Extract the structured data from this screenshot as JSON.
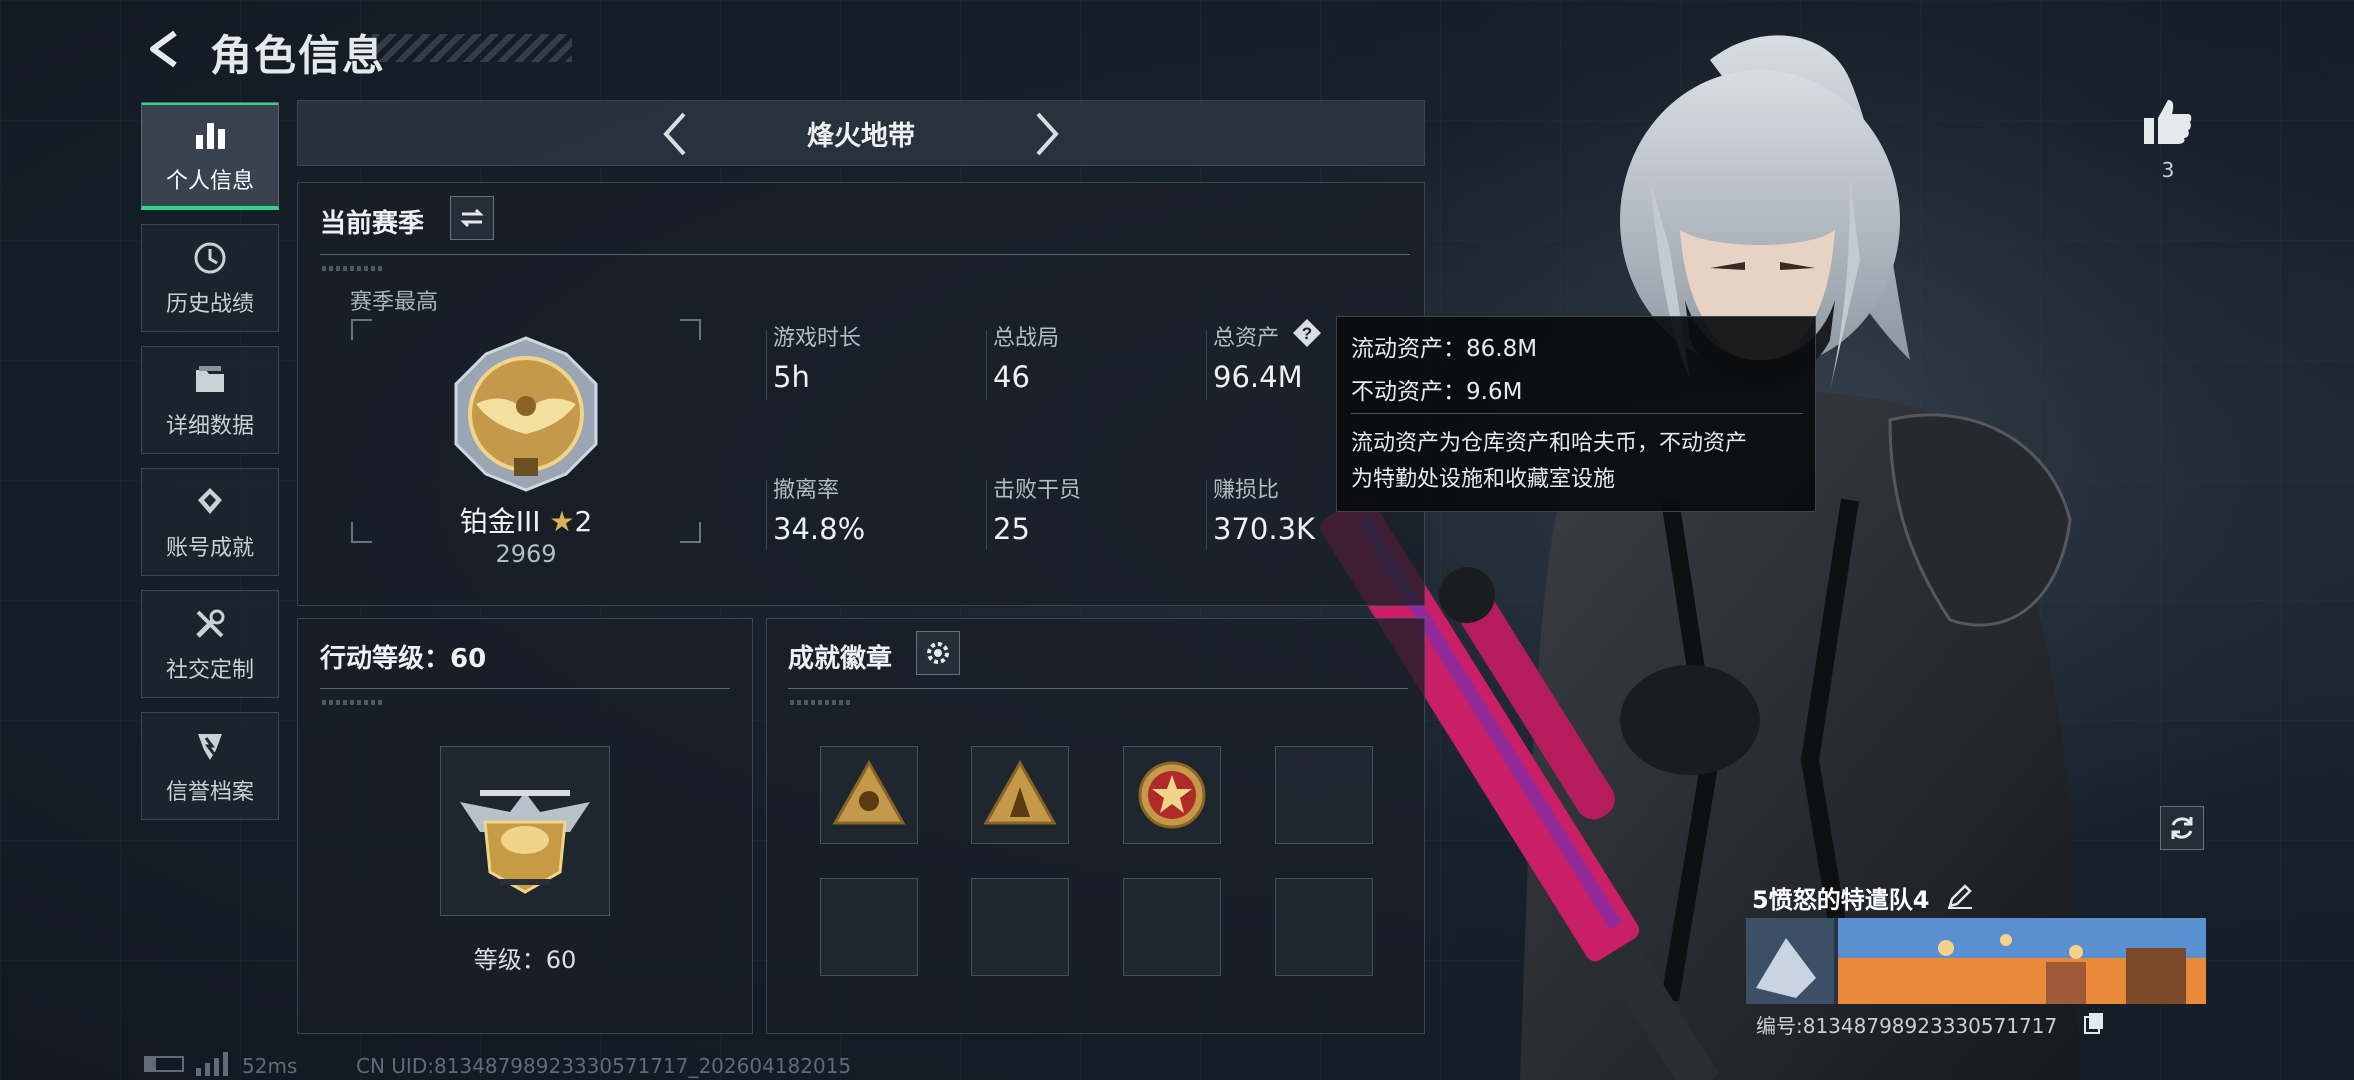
{
  "header": {
    "title": "角色信息"
  },
  "sidebar": {
    "items": [
      {
        "label": "个人信息",
        "icon": "bar-chart-icon",
        "active": true
      },
      {
        "label": "历史战绩",
        "icon": "history-icon",
        "active": false
      },
      {
        "label": "详细数据",
        "icon": "folder-icon",
        "active": false
      },
      {
        "label": "账号成就",
        "icon": "achievement-icon",
        "active": false
      },
      {
        "label": "社交定制",
        "icon": "tools-icon",
        "active": false
      },
      {
        "label": "信誉档案",
        "icon": "reputation-icon",
        "active": false
      }
    ]
  },
  "mode": {
    "title": "烽火地带"
  },
  "season": {
    "title": "当前赛季",
    "best_label": "赛季最高",
    "rank_name": "铂金III",
    "rank_stars": "2",
    "rank_score": "2969",
    "stats": [
      {
        "label": "游戏时长",
        "value": "5h"
      },
      {
        "label": "总战局",
        "value": "46"
      },
      {
        "label": "总资产",
        "value": "96.4M"
      },
      {
        "label": "撤离率",
        "value": "34.8%"
      },
      {
        "label": "击败干员",
        "value": "25"
      },
      {
        "label": "赚损比",
        "value": "370.3K"
      }
    ]
  },
  "tooltip": {
    "line1": "流动资产：86.8M",
    "line2": "不动资产：9.6M",
    "desc1": "流动资产为仓库资产和哈夫币，不动资产",
    "desc2": "为特勤处设施和收藏室设施"
  },
  "action_level": {
    "title": "行动等级：60",
    "level_text": "等级：60"
  },
  "badges": {
    "title": "成就徽章",
    "slots": [
      {
        "icon": "triangle-badge-icon",
        "filled": true
      },
      {
        "icon": "triangle-badge-2-icon",
        "filled": true
      },
      {
        "icon": "star-emblem-icon",
        "filled": true
      },
      {
        "icon": "",
        "filled": false
      },
      {
        "icon": "",
        "filled": false
      },
      {
        "icon": "",
        "filled": false
      },
      {
        "icon": "",
        "filled": false
      },
      {
        "icon": "",
        "filled": false
      }
    ]
  },
  "likes": {
    "count": "3"
  },
  "player": {
    "name": "5愤怒的特遣队4",
    "id_text": "编号:81348798923330571717"
  },
  "status_bar": {
    "ping": "52ms",
    "uid": "CN UID:81348798923330571717_202604182015"
  },
  "colors": {
    "accent_green": "#2fd58b",
    "panel_bg": "#181f27",
    "rifle_pink": "#d0206e"
  }
}
